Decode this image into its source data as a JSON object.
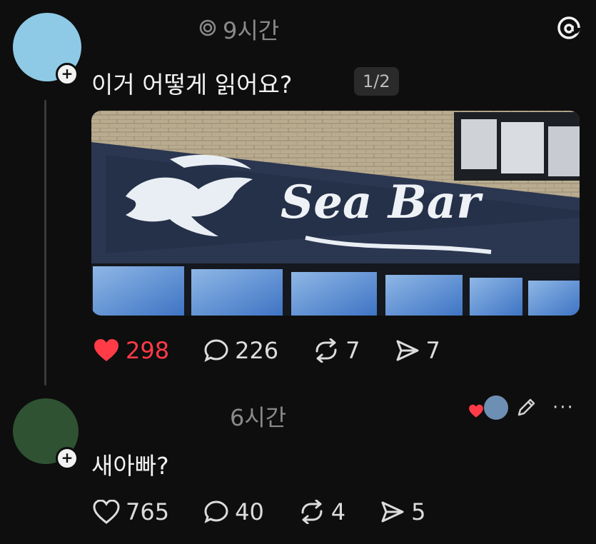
{
  "post": {
    "avatar_color": "#8ecae6",
    "time": "9시간",
    "text": "이거 어떻게 읽어요?",
    "pager": "1/2",
    "image_sign_text": "Sea Bar",
    "likes": "298",
    "comments": "226",
    "reposts": "7",
    "shares": "7",
    "liked": true,
    "like_color": "#ff3b47"
  },
  "reply": {
    "avatar_color": "#2f5233",
    "time": "6시간",
    "text": "새아빠?",
    "likes": "765",
    "comments": "40",
    "reposts": "4",
    "shares": "5"
  },
  "icons": {
    "app_logo": "threads-icon",
    "more": "more-icon",
    "edit": "pencil-icon"
  },
  "more_label": "···"
}
